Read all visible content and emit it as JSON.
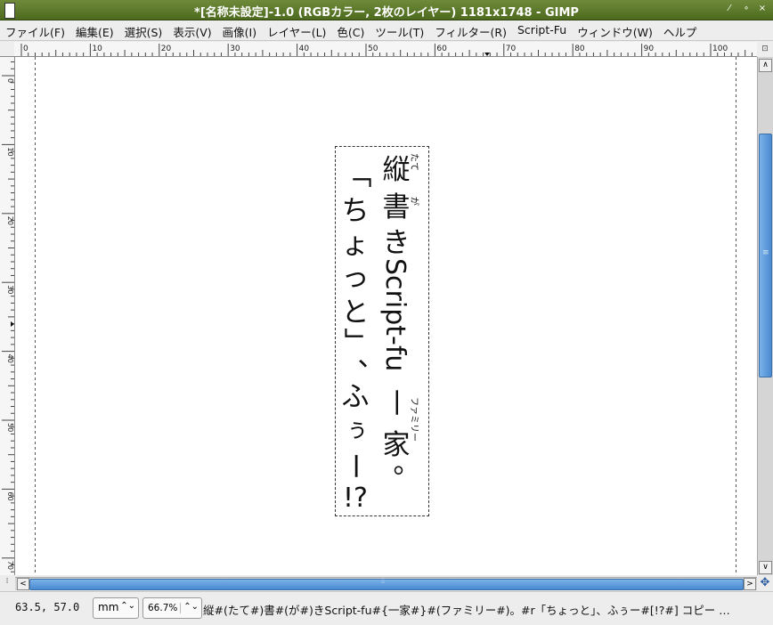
{
  "window": {
    "title": "*[名称未設定]-1.0 (RGBカラー, 2枚のレイヤー) 1181x1748 - GIMP",
    "controls": [
      "⁄",
      "∘",
      "×"
    ]
  },
  "menu": [
    "ファイル(F)",
    "編集(E)",
    "選択(S)",
    "表示(V)",
    "画像(I)",
    "レイヤー(L)",
    "色(C)",
    "ツール(T)",
    "フィルター(R)",
    "Script-Fu",
    "ウィンドウ(W)",
    "ヘルプ"
  ],
  "ruler": {
    "h_labels": [
      "0",
      "10",
      "20",
      "30",
      "40",
      "50",
      "60",
      "70",
      "80",
      "90",
      "100"
    ],
    "v_labels": [
      "0",
      "10",
      "20",
      "30",
      "40",
      "50",
      "60",
      "70",
      "80"
    ]
  },
  "canvas_text": {
    "main_columns": [
      [
        "縦",
        "書",
        "き",
        "S",
        "c",
        "r",
        "i",
        "p",
        "t",
        "-",
        "f",
        "u",
        "一",
        "家",
        "。"
      ],
      [
        "「",
        "ち",
        "ょ",
        "っ",
        "と",
        "」",
        "、",
        "ふ",
        "ぅ",
        "ー",
        "!?"
      ]
    ],
    "ruby": [
      {
        "base": "縦",
        "text": "たて"
      },
      {
        "base": "書",
        "text": "が"
      },
      {
        "base": "一家",
        "text": "ファミリー"
      }
    ]
  },
  "status": {
    "coords": "63.5, 57.0",
    "unit": "mm",
    "zoom": "66.7%",
    "message": "縦#(たて#)書#(が#)きScript-fu#{一家#}#(ファミリー#)。#r「ちょっと」、ふぅー#[!?#] コピー …"
  },
  "scroll": {
    "up": "∧",
    "down": "∨",
    "left": "<",
    "right": ">",
    "nav": "✥",
    "grip": "⁞"
  }
}
